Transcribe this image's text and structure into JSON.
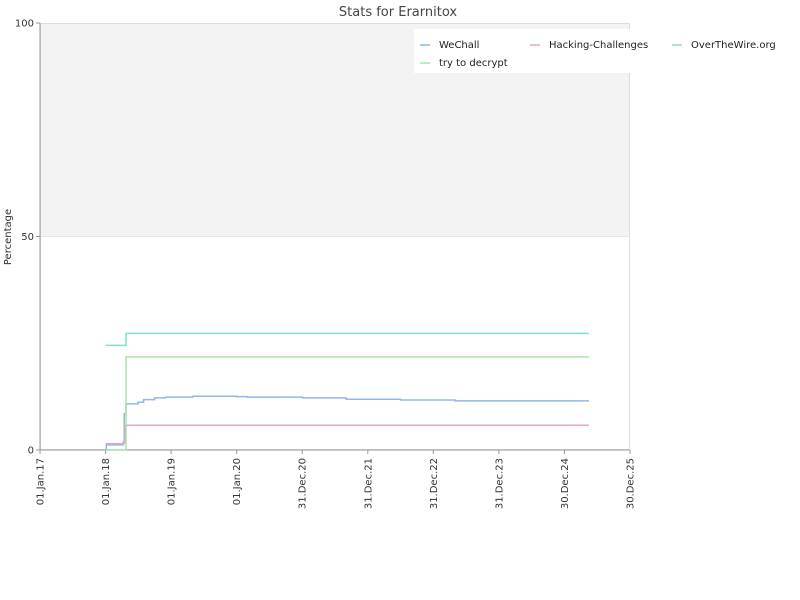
{
  "chart_data": {
    "type": "line",
    "title": "Stats for Erarnitox",
    "xlabel": "",
    "ylabel": "Percentage",
    "ylim": [
      0,
      100
    ],
    "yticks": [
      "0",
      "50",
      "100"
    ],
    "xlim": [
      "2017-01-01",
      "2025-12-30"
    ],
    "xticks": [
      {
        "date": "2017-01-01",
        "label": "01.Jan.17"
      },
      {
        "date": "2018-01-01",
        "label": "01.Jan.18"
      },
      {
        "date": "2019-01-01",
        "label": "01.Jan.19"
      },
      {
        "date": "2020-01-01",
        "label": "01.Jan.20"
      },
      {
        "date": "2020-12-31",
        "label": "31.Dec.20"
      },
      {
        "date": "2021-12-31",
        "label": "31.Dec.21"
      },
      {
        "date": "2022-12-31",
        "label": "31.Dec.22"
      },
      {
        "date": "2023-12-31",
        "label": "31.Dec.23"
      },
      {
        "date": "2024-12-30",
        "label": "30.Dec.24"
      },
      {
        "date": "2025-12-30",
        "label": "30.Dec.25"
      }
    ],
    "upper_band": {
      "from": 50,
      "to": 100,
      "color": "#f3f3f3"
    },
    "legend_position": "top-right",
    "grid": false,
    "step": true,
    "series": [
      {
        "name": "WeChall",
        "color": "#8db8e8",
        "points": [
          [
            "2018-01-01",
            0
          ],
          [
            "2018-01-05",
            1.2
          ],
          [
            "2018-04-10",
            1.8
          ],
          [
            "2018-04-15",
            8.5
          ],
          [
            "2018-04-25",
            10.8
          ],
          [
            "2018-07-01",
            11.2
          ],
          [
            "2018-08-01",
            11.8
          ],
          [
            "2018-10-01",
            12.2
          ],
          [
            "2018-12-01",
            12.4
          ],
          [
            "2019-05-01",
            12.6
          ],
          [
            "2020-01-01",
            12.5
          ],
          [
            "2020-03-01",
            12.4
          ],
          [
            "2021-01-01",
            12.2
          ],
          [
            "2021-09-01",
            11.9
          ],
          [
            "2022-07-01",
            11.7
          ],
          [
            "2023-05-01",
            11.5
          ],
          [
            "2025-05-15",
            11.5
          ]
        ]
      },
      {
        "name": "Hacking-Challenges",
        "color": "#e8a3c8",
        "points": [
          [
            "2018-01-01",
            1.5
          ],
          [
            "2018-04-10",
            1.6
          ],
          [
            "2018-04-20",
            5.8
          ],
          [
            "2025-05-15",
            5.8
          ]
        ]
      },
      {
        "name": "OverTheWire.org",
        "color": "#7fe0cf",
        "points": [
          [
            "2018-01-01",
            24.5
          ],
          [
            "2018-04-20",
            24.5
          ],
          [
            "2018-04-25",
            27.3
          ],
          [
            "2025-05-15",
            27.3
          ]
        ]
      },
      {
        "name": "try to decrypt",
        "color": "#a6e6a6",
        "points": [
          [
            "2018-01-01",
            0
          ],
          [
            "2018-04-20",
            0
          ],
          [
            "2018-04-25",
            21.8
          ],
          [
            "2025-05-15",
            21.8
          ]
        ]
      }
    ]
  }
}
